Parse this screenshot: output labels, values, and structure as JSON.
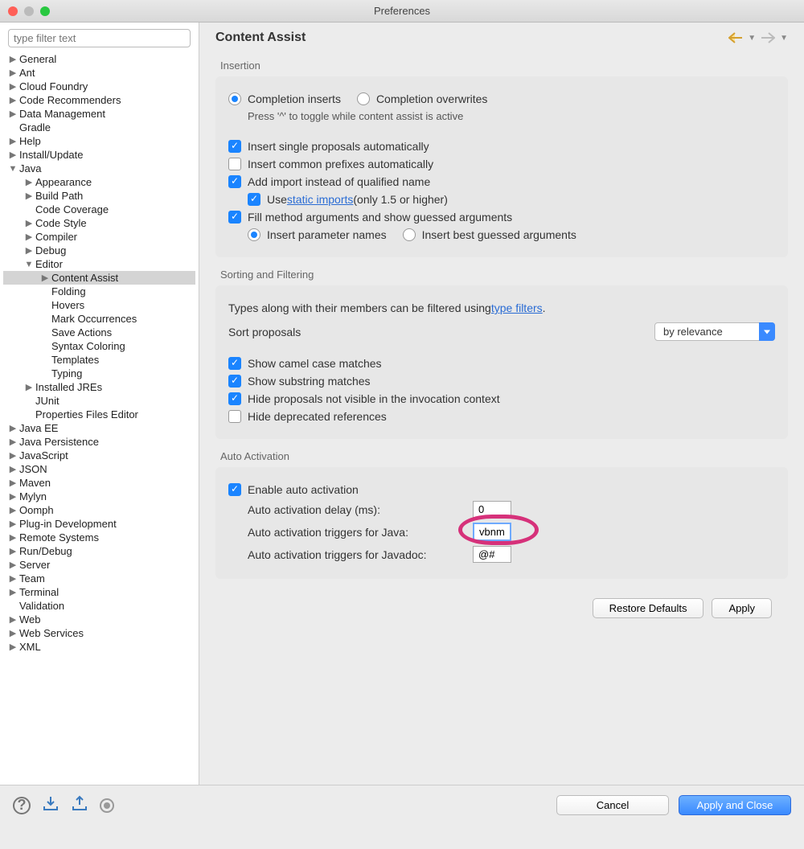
{
  "window": {
    "title": "Preferences"
  },
  "sidebar": {
    "filter_placeholder": "type filter text",
    "tree": [
      {
        "label": "General",
        "depth": 0,
        "arrow": "▶"
      },
      {
        "label": "Ant",
        "depth": 0,
        "arrow": "▶"
      },
      {
        "label": "Cloud Foundry",
        "depth": 0,
        "arrow": "▶"
      },
      {
        "label": "Code Recommenders",
        "depth": 0,
        "arrow": "▶"
      },
      {
        "label": "Data Management",
        "depth": 0,
        "arrow": "▶"
      },
      {
        "label": "Gradle",
        "depth": 0,
        "arrow": ""
      },
      {
        "label": "Help",
        "depth": 0,
        "arrow": "▶"
      },
      {
        "label": "Install/Update",
        "depth": 0,
        "arrow": "▶"
      },
      {
        "label": "Java",
        "depth": 0,
        "arrow": "▼"
      },
      {
        "label": "Appearance",
        "depth": 1,
        "arrow": "▶"
      },
      {
        "label": "Build Path",
        "depth": 1,
        "arrow": "▶"
      },
      {
        "label": "Code Coverage",
        "depth": 1,
        "arrow": ""
      },
      {
        "label": "Code Style",
        "depth": 1,
        "arrow": "▶"
      },
      {
        "label": "Compiler",
        "depth": 1,
        "arrow": "▶"
      },
      {
        "label": "Debug",
        "depth": 1,
        "arrow": "▶"
      },
      {
        "label": "Editor",
        "depth": 1,
        "arrow": "▼"
      },
      {
        "label": "Content Assist",
        "depth": 2,
        "arrow": "▶",
        "selected": true
      },
      {
        "label": "Folding",
        "depth": 2,
        "arrow": ""
      },
      {
        "label": "Hovers",
        "depth": 2,
        "arrow": ""
      },
      {
        "label": "Mark Occurrences",
        "depth": 2,
        "arrow": ""
      },
      {
        "label": "Save Actions",
        "depth": 2,
        "arrow": ""
      },
      {
        "label": "Syntax Coloring",
        "depth": 2,
        "arrow": ""
      },
      {
        "label": "Templates",
        "depth": 2,
        "arrow": ""
      },
      {
        "label": "Typing",
        "depth": 2,
        "arrow": ""
      },
      {
        "label": "Installed JREs",
        "depth": 1,
        "arrow": "▶"
      },
      {
        "label": "JUnit",
        "depth": 1,
        "arrow": ""
      },
      {
        "label": "Properties Files Editor",
        "depth": 1,
        "arrow": ""
      },
      {
        "label": "Java EE",
        "depth": 0,
        "arrow": "▶"
      },
      {
        "label": "Java Persistence",
        "depth": 0,
        "arrow": "▶"
      },
      {
        "label": "JavaScript",
        "depth": 0,
        "arrow": "▶"
      },
      {
        "label": "JSON",
        "depth": 0,
        "arrow": "▶"
      },
      {
        "label": "Maven",
        "depth": 0,
        "arrow": "▶"
      },
      {
        "label": "Mylyn",
        "depth": 0,
        "arrow": "▶"
      },
      {
        "label": "Oomph",
        "depth": 0,
        "arrow": "▶"
      },
      {
        "label": "Plug-in Development",
        "depth": 0,
        "arrow": "▶"
      },
      {
        "label": "Remote Systems",
        "depth": 0,
        "arrow": "▶"
      },
      {
        "label": "Run/Debug",
        "depth": 0,
        "arrow": "▶"
      },
      {
        "label": "Server",
        "depth": 0,
        "arrow": "▶"
      },
      {
        "label": "Team",
        "depth": 0,
        "arrow": "▶"
      },
      {
        "label": "Terminal",
        "depth": 0,
        "arrow": "▶"
      },
      {
        "label": "Validation",
        "depth": 0,
        "arrow": ""
      },
      {
        "label": "Web",
        "depth": 0,
        "arrow": "▶"
      },
      {
        "label": "Web Services",
        "depth": 0,
        "arrow": "▶"
      },
      {
        "label": "XML",
        "depth": 0,
        "arrow": "▶"
      }
    ]
  },
  "content": {
    "title": "Content Assist",
    "insertion": {
      "heading": "Insertion",
      "completion_inserts": "Completion inserts",
      "completion_overwrites": "Completion overwrites",
      "toggle_hint": "Press '^' to toggle while content assist is active",
      "insert_single": "Insert single proposals automatically",
      "insert_common": "Insert common prefixes automatically",
      "add_import": "Add import instead of qualified name",
      "use_static_pre": "Use ",
      "use_static_link": "static imports",
      "use_static_post": " (only 1.5 or higher)",
      "fill_method": "Fill method arguments and show guessed arguments",
      "insert_param_names": "Insert parameter names",
      "insert_best_guessed": "Insert best guessed arguments"
    },
    "sorting": {
      "heading": "Sorting and Filtering",
      "types_pre": "Types along with their members can be filtered using ",
      "types_link": "type filters",
      "types_post": ".",
      "sort_proposals": "Sort proposals",
      "sort_value": "by relevance",
      "show_camel": "Show camel case matches",
      "show_substring": "Show substring matches",
      "hide_proposals": "Hide proposals not visible in the invocation context",
      "hide_deprecated": "Hide deprecated references"
    },
    "auto": {
      "heading": "Auto Activation",
      "enable": "Enable auto activation",
      "delay_label": "Auto activation delay (ms):",
      "delay_value": "0",
      "java_label": "Auto activation triggers for Java:",
      "java_value": "vbnm",
      "javadoc_label": "Auto activation triggers for Javadoc:",
      "javadoc_value": "@#"
    },
    "buttons": {
      "restore": "Restore Defaults",
      "apply": "Apply"
    }
  },
  "footer": {
    "cancel": "Cancel",
    "apply_close": "Apply and Close"
  }
}
